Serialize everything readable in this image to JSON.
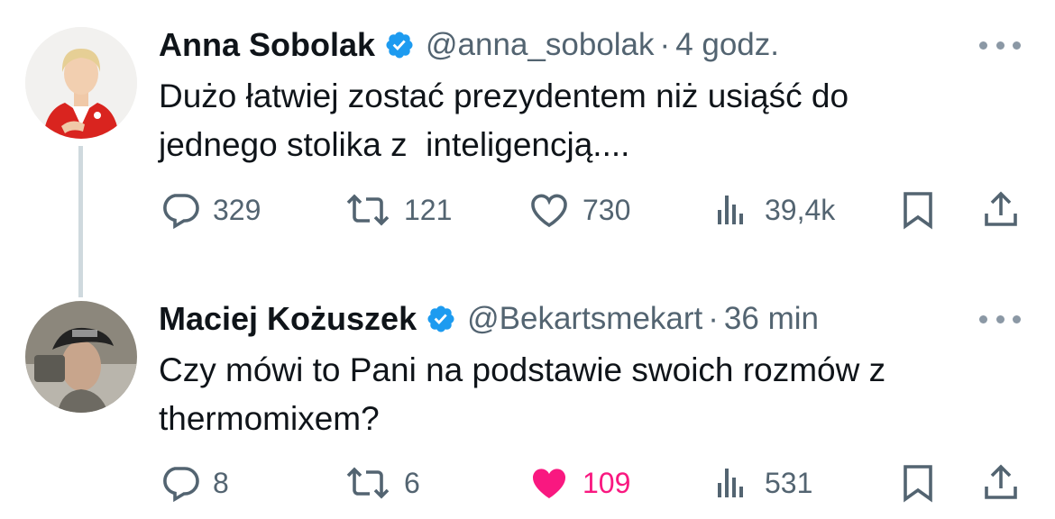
{
  "tweets": [
    {
      "name": "Anna Sobolak",
      "handle": "@anna_sobolak",
      "separator": "·",
      "time": "4 godz.",
      "text": "Dużo łatwiej zostać prezydentem niż usiąść do\njednego stolika z  inteligencją....",
      "replies": "329",
      "reposts": "121",
      "likes": "730",
      "views": "39,4k",
      "liked": false
    },
    {
      "name": "Maciej Kożuszek",
      "handle": "@Bekartsmekart",
      "separator": "·",
      "time": "36 min",
      "text": "Czy mówi to Pani na podstawie swoich rozmów z\nthermomixem?",
      "replies": "8",
      "reposts": "6",
      "likes": "109",
      "views": "531",
      "liked": true
    }
  ],
  "colors": {
    "verified": "#1d9bf0",
    "muted": "#536471",
    "like_active": "#f91880",
    "thread_line": "#cfd9de"
  },
  "icons": [
    "verified-icon",
    "more-icon",
    "reply-icon",
    "repost-icon",
    "like-icon",
    "views-icon",
    "bookmark-icon",
    "share-icon"
  ]
}
